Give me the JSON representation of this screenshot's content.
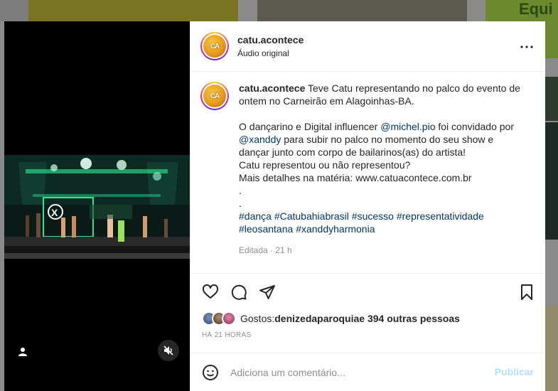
{
  "background": {
    "tile_text": "Equi"
  },
  "post": {
    "username": "catu.acontece",
    "audio_label": "Áudio original",
    "avatar_initials": "CA",
    "caption": {
      "username": "catu.acontece",
      "line1": "Teve Catu representando no palco do evento de ontem no Carneirão em Alagoinhas-BA.",
      "p2_before": "O dançarino e Digital influencer ",
      "mention1": "@michel.pio",
      "p2_mid": " foi convidado por ",
      "mention2": "@xanddy",
      "p2_after": " para subir no palco no momento do seu show e dançar junto com corpo de bailarinos(as) do artista!",
      "line3": "Catu representou ou não representou?",
      "line4": "Mais detalhes na matéria: www.catuacontece.com.br",
      "dot1": ".",
      "dot2": ".",
      "hashtags": [
        "#dança",
        "#Catubahiabrasil",
        "#sucesso",
        "#representatividade",
        "#leosantana",
        "#xanddyharmonia"
      ]
    },
    "edited_label": "Editada",
    "edited_time": "21 h",
    "likes": {
      "prefix": "Gostos: ",
      "user": "denizedaparoquia",
      "suffix": " e 394 outras pessoas"
    },
    "timestamp": "HÁ 21 HORAS",
    "comment_placeholder": "Adiciona um comentário...",
    "publish_label": "Publicar"
  },
  "icons": {
    "more": "more-horizontal-icon",
    "like": "heart-icon",
    "comment": "comment-icon",
    "share": "share-icon",
    "save": "bookmark-icon",
    "emoji": "emoji-icon",
    "mute": "muted-speaker-icon",
    "tag": "user-tag-icon"
  },
  "colors": {
    "link": "#00376b",
    "publish_disabled": "#b2dffc",
    "muted_text": "#8e8e8e"
  }
}
